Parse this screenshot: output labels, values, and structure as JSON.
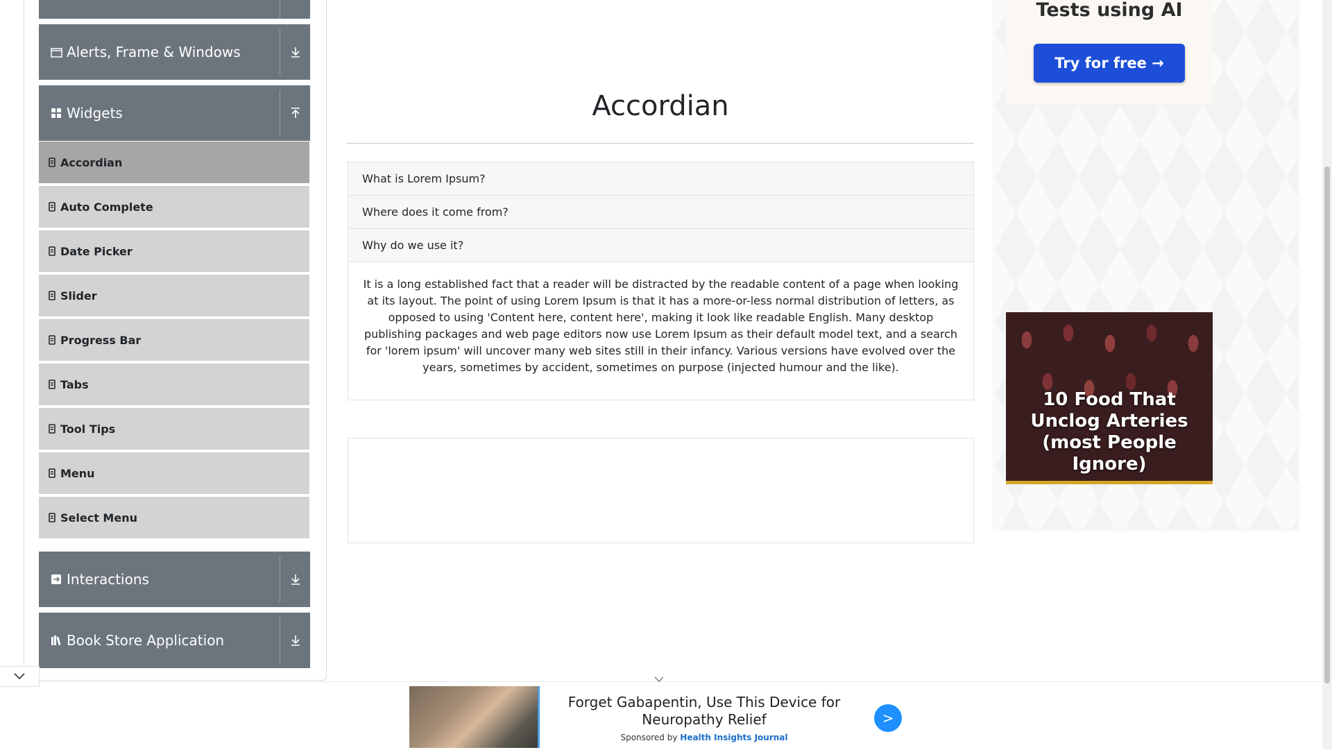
{
  "sidebar": {
    "groups": [
      {
        "label": ""
      },
      {
        "label": "Alerts, Frame & Windows"
      },
      {
        "label": "Widgets"
      },
      {
        "label": "Interactions"
      },
      {
        "label": "Book Store Application"
      }
    ],
    "widget_items": [
      {
        "label": "Accordian"
      },
      {
        "label": "Auto Complete"
      },
      {
        "label": "Date Picker"
      },
      {
        "label": "Slider"
      },
      {
        "label": "Progress Bar"
      },
      {
        "label": "Tabs"
      },
      {
        "label": "Tool Tips"
      },
      {
        "label": "Menu"
      },
      {
        "label": "Select Menu"
      }
    ]
  },
  "main": {
    "title": "Accordian",
    "sections": [
      {
        "header": "What is Lorem Ipsum?"
      },
      {
        "header": "Where does it come from?"
      },
      {
        "header": "Why do we use it?"
      }
    ],
    "expanded_body": "It is a long established fact that a reader will be distracted by the readable content of a page when looking at its layout. The point of using Lorem Ipsum is that it has a more-or-less normal distribution of letters, as opposed to using 'Content here, content here', making it look like readable English. Many desktop publishing packages and web page editors now use Lorem Ipsum as their default model text, and a search for 'lorem ipsum' will uncover many web sites still in their infancy. Various versions have evolved over the years, sometimes by accident, sometimes on purpose (injected humour and the like)."
  },
  "ads": {
    "top_title": "Tests using AI",
    "try_button": "Try for free →",
    "food_text": "10 Food That Unclog Arteries (most People Ignore)",
    "bottom_text": "Forget Gabapentin, Use This Device for Neuropathy Relief",
    "bottom_sponsor_prefix": "Sponsored by",
    "bottom_sponsor_brand": "Health Insights Journal",
    "bottom_button": ">"
  },
  "colors": {
    "sidebar_header": "#6c757d",
    "menu_item": "#d3d3d3",
    "menu_item_active": "#a6a6a6",
    "try_button": "#1d4ed8",
    "bottom_ad_button": "#1e90ff"
  }
}
